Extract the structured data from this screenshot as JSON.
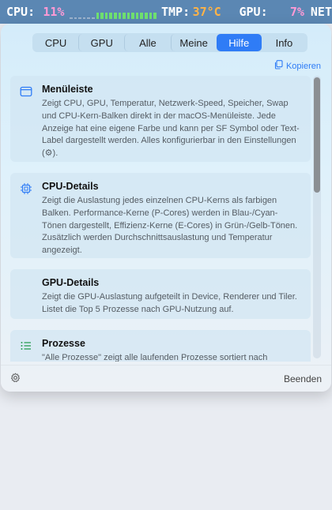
{
  "menubar": {
    "cpu_label": "CPU:",
    "cpu_value": "11%",
    "core_bars": [
      0,
      0,
      0,
      0,
      0,
      0,
      1,
      1,
      1,
      1,
      1,
      1,
      1,
      1,
      1,
      1,
      1,
      1,
      1,
      1
    ],
    "tmp_label": "TMP:",
    "tmp_value": "37°C",
    "gpu_label": "GPU:",
    "gpu_value": "7%",
    "net_label": "NET"
  },
  "tabs": [
    {
      "label": "CPU",
      "active": false
    },
    {
      "label": "GPU",
      "active": false
    },
    {
      "label": "Alle",
      "active": false
    },
    {
      "label": "Meine",
      "active": false
    },
    {
      "label": "Hilfe",
      "active": true
    },
    {
      "label": "Info",
      "active": false
    }
  ],
  "copy_label": "Kopieren",
  "cards": [
    {
      "icon": "menubar-icon",
      "title": "Menüleiste",
      "text": "Zeigt CPU, GPU, Temperatur, Netzwerk-Speed, Speicher, Swap und CPU-Kern-Balken direkt in der macOS-Menüleiste. Jede Anzeige hat eine eigene Farbe und kann per SF Symbol oder Text-Label dargestellt werden. Alles konfigurierbar in den Einstellungen (⚙)."
    },
    {
      "icon": "cpu-chip-icon",
      "title": "CPU-Details",
      "text": "Zeigt die Auslastung jedes einzelnen CPU-Kerns als farbigen Balken. Performance-Kerne (P-Cores) werden in Blau-/Cyan-Tönen dargestellt, Effizienz-Kerne (E-Cores) in Grün-/Gelb-Tönen. Zusätzlich werden Durchschnittsauslastung und Temperatur angezeigt."
    },
    {
      "icon": "",
      "title": "GPU-Details",
      "text": "Zeigt die GPU-Auslastung aufgeteilt in Device, Renderer und Tiler. Listet die Top 5 Prozesse nach GPU-Nutzung auf."
    },
    {
      "icon": "list-icon",
      "title": "Prozesse",
      "text": "\"Alle Prozesse\" zeigt alle laufenden Prozesse sortiert nach"
    }
  ],
  "scroll_position": 0.0,
  "quit_label": "Beenden",
  "colors": {
    "accent": "#2f7cf6",
    "menubar_bg": "#5b87b3",
    "cpu_value": "#ff9ad5",
    "tmp_value": "#ffb347",
    "core_bar": "#6fe06f"
  }
}
